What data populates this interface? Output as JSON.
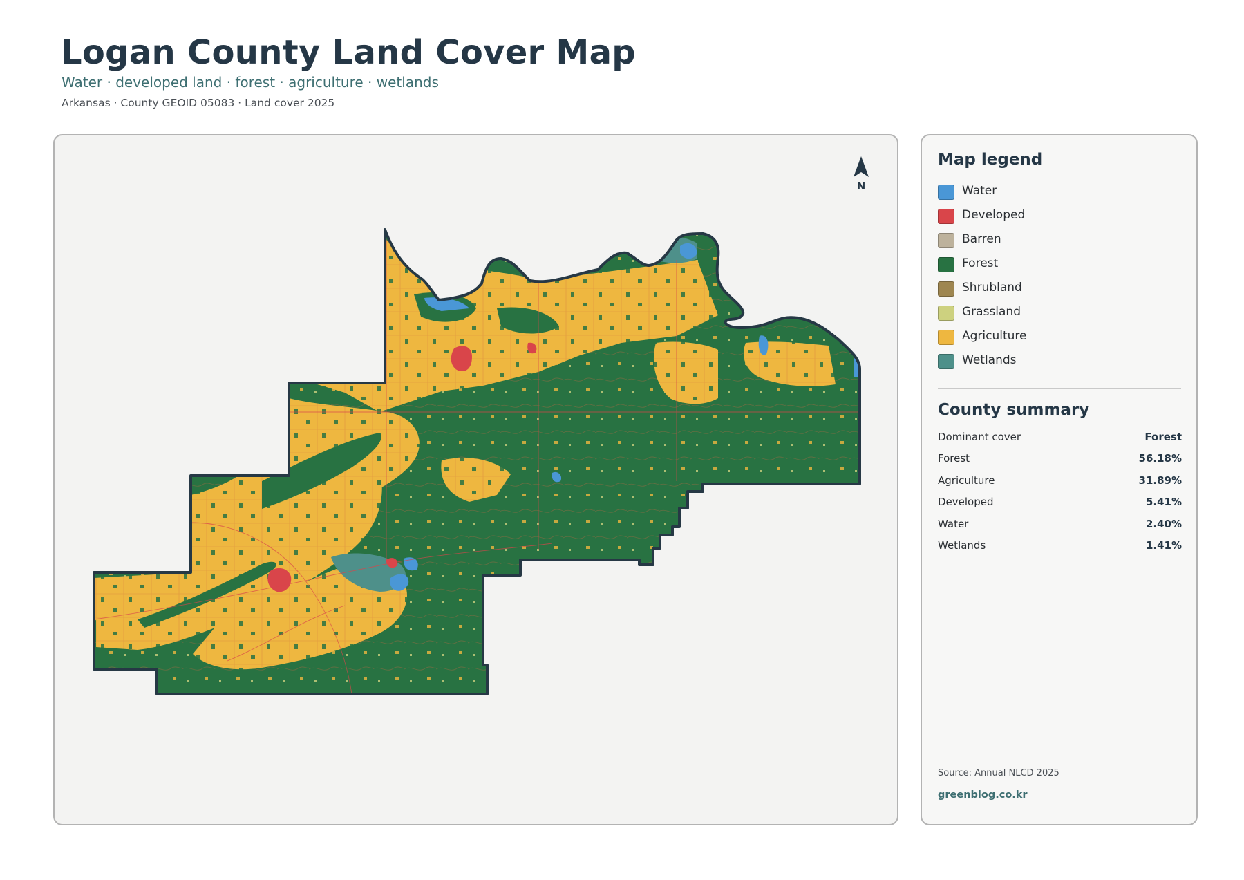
{
  "header": {
    "title": "Logan County Land Cover Map",
    "subtitle": "Water · developed land · forest · agriculture · wetlands",
    "meta": "Arkansas · County GEOID 05083 · Land cover 2025"
  },
  "map": {
    "north_label": "N",
    "palette": {
      "water": "#4a97d6",
      "developed": "#d9454a",
      "barren": "#bdb29c",
      "forest": "#287242",
      "shrubland": "#9e8650",
      "grassland": "#cdd17f",
      "agriculture": "#eeb740",
      "wetlands": "#4e908a",
      "outline": "#263845"
    }
  },
  "legend": {
    "title": "Map legend",
    "items": [
      {
        "label": "Water",
        "color": "#4a97d6"
      },
      {
        "label": "Developed",
        "color": "#d9454a"
      },
      {
        "label": "Barren",
        "color": "#bdb29c"
      },
      {
        "label": "Forest",
        "color": "#287242"
      },
      {
        "label": "Shrubland",
        "color": "#9e8650"
      },
      {
        "label": "Grassland",
        "color": "#cdd17f"
      },
      {
        "label": "Agriculture",
        "color": "#eeb740"
      },
      {
        "label": "Wetlands",
        "color": "#4e908a"
      }
    ]
  },
  "summary": {
    "title": "County summary",
    "rows": [
      {
        "label": "Dominant cover",
        "value": "Forest"
      },
      {
        "label": "Forest",
        "value": "56.18%"
      },
      {
        "label": "Agriculture",
        "value": "31.89%"
      },
      {
        "label": "Developed",
        "value": "5.41%"
      },
      {
        "label": "Water",
        "value": "2.40%"
      },
      {
        "label": "Wetlands",
        "value": "1.41%"
      }
    ]
  },
  "footer": {
    "source": "Source: Annual NLCD 2025",
    "brand": "greenblog.co.kr"
  }
}
